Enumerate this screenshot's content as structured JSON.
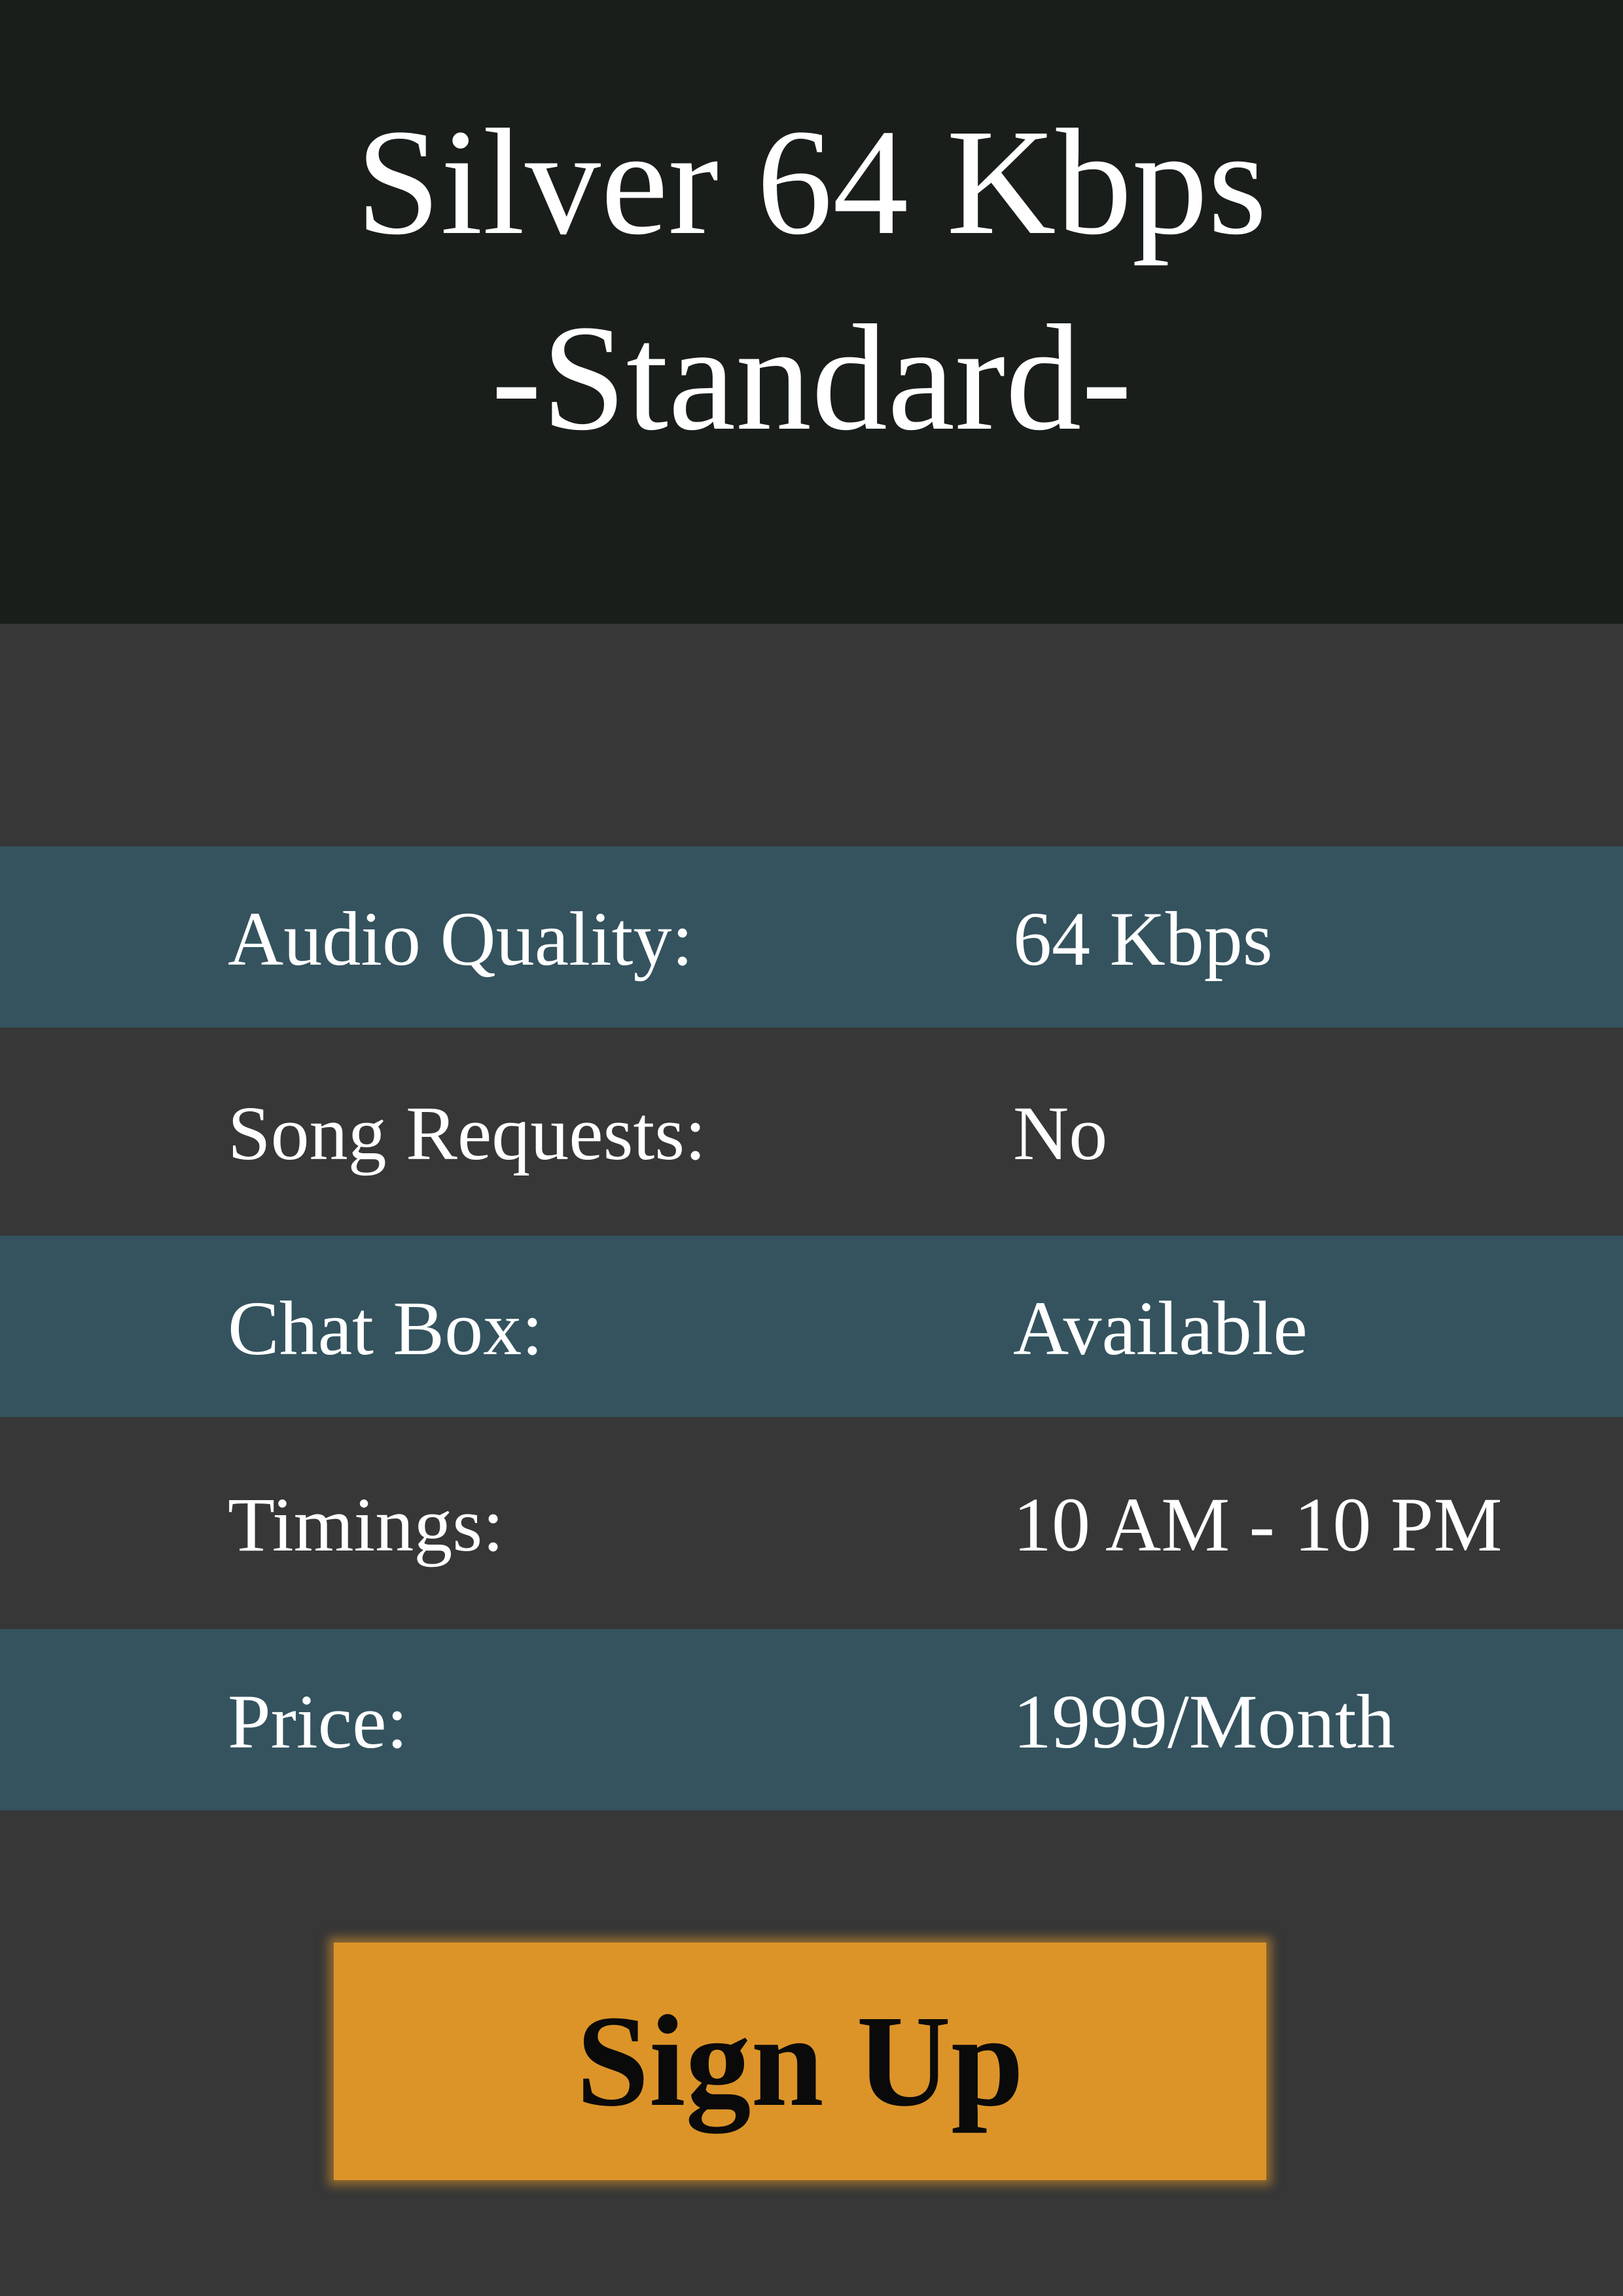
{
  "header": {
    "title_line1": "Silver 64 Kbps",
    "title_line2": "-Standard-"
  },
  "plan_details": [
    {
      "label": "Audio Quality:",
      "value": "64 Kbps"
    },
    {
      "label": "Song Requests:",
      "value": "No"
    },
    {
      "label": "Chat Box:",
      "value": "Available"
    },
    {
      "label": "Timings:",
      "value": "10 AM - 10 PM"
    },
    {
      "label": "Price:",
      "value": "1999/Month"
    }
  ],
  "signup_button": {
    "label": "Sign Up"
  },
  "colors": {
    "header_bg": "#1a1e1b",
    "page_bg": "#373737",
    "row_teal": "#34535e",
    "button_bg": "#dc9429",
    "text_light": "#ffffff",
    "button_text": "#0a0a0a"
  }
}
